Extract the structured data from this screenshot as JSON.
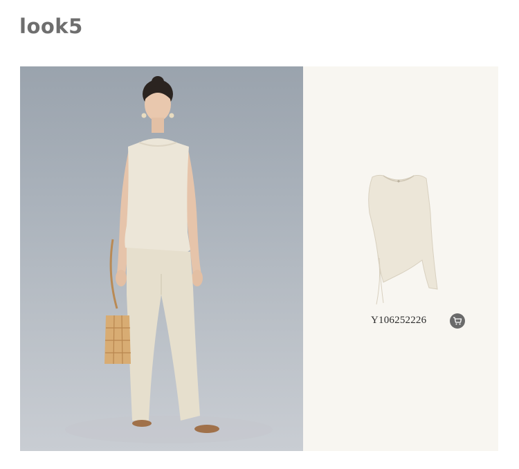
{
  "page": {
    "title": "look5"
  },
  "model_photo": {
    "description_icon": "model-photo"
  },
  "product": {
    "code": "Y106252226",
    "cart_icon": "cart-icon"
  },
  "colors": {
    "title_text": "#6e6e6e",
    "right_panel_bg": "#f8f6f1",
    "garment": "#ece6d8",
    "cart_button_bg": "#6a6a6a"
  }
}
